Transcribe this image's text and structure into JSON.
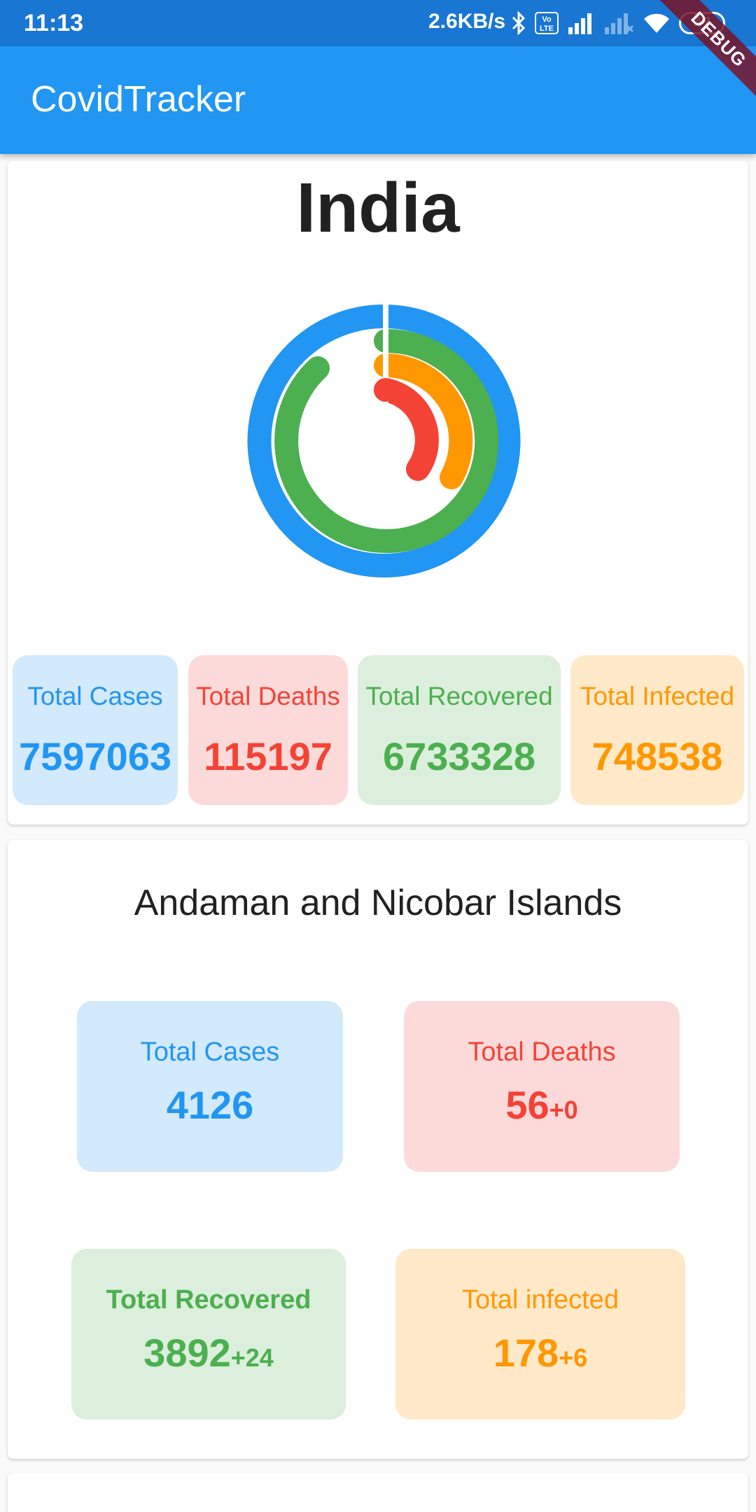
{
  "status_bar": {
    "time": "11:13",
    "speed": "2.6KB/s",
    "battery": "47",
    "icons": [
      "bluetooth-icon",
      "volte-icon",
      "signal-icon",
      "signal-weak-icon",
      "wifi-icon",
      "battery-icon"
    ]
  },
  "debug_banner": "DEBUG",
  "app_bar": {
    "title": "CovidTracker"
  },
  "country": {
    "name": "India",
    "total_cases": {
      "label": "Total Cases",
      "value": "7597063"
    },
    "total_deaths": {
      "label": "Total Deaths",
      "value": "115197"
    },
    "total_recovered": {
      "label": "Total Recovered",
      "value": "6733328"
    },
    "total_infected": {
      "label": "Total Infected",
      "value": "748538"
    }
  },
  "state": {
    "name": "Andaman and Nicobar Islands",
    "total_cases": {
      "label": "Total Cases",
      "value": "4126"
    },
    "total_deaths": {
      "label": "Total Deaths",
      "value": "56",
      "delta": "+0"
    },
    "total_recovered": {
      "label": "Total Recovered",
      "value": "3892",
      "delta": "+24"
    },
    "total_infected": {
      "label": "Total infected",
      "value": "178",
      "delta": "+6"
    }
  },
  "colors": {
    "app_bar": "#2196F3",
    "status_bar": "#1976D2",
    "cases": "#2196F3",
    "deaths": "#F44336",
    "recovered": "#4CAF50",
    "infected": "#FF9800"
  }
}
